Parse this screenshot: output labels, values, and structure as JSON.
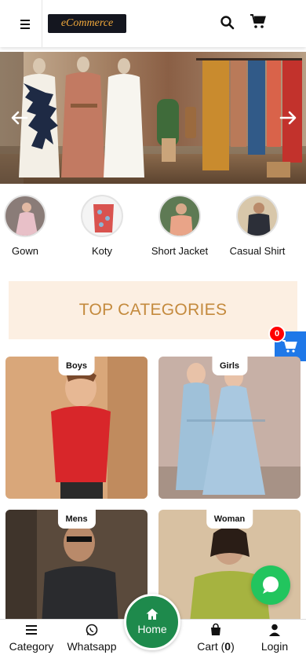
{
  "header": {
    "logo_text": "eCommerce",
    "cart_count": "0"
  },
  "hero": {
    "prev_icon": "arrow-left-icon",
    "next_icon": "arrow-right-icon"
  },
  "mini_categories": [
    {
      "label": "Gown"
    },
    {
      "label": "Koty"
    },
    {
      "label": "Short Jacket"
    },
    {
      "label": "Casual Shirt"
    }
  ],
  "top_categories": {
    "heading": "TOP CATEGORIES",
    "cards": [
      {
        "label": "Boys"
      },
      {
        "label": "Girls"
      },
      {
        "label": "Mens"
      },
      {
        "label": "Woman"
      }
    ]
  },
  "side_cart": {
    "count": "0"
  },
  "bottom_nav": {
    "category": "Category",
    "whatsapp": "Whatsapp",
    "home": "Home",
    "cart_label": "Cart (",
    "cart_count": "0",
    "cart_close": ")",
    "login": "Login"
  },
  "colors": {
    "accent_green": "#1e8a4c",
    "whatsapp_green": "#22c55e",
    "cart_blue": "#1f78e8",
    "badge_red": "#ff0000",
    "heading_gold": "#c48a3d",
    "heading_bg": "#fcefe2"
  }
}
